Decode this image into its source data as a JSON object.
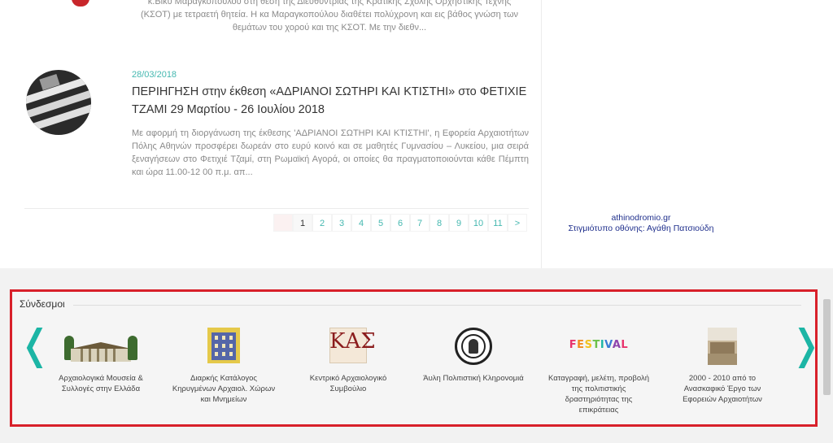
{
  "articles": {
    "top_excerpt": "κ.Βίκυ Μαραγκοπούλου στη θέση της Διευθύντριας της Κρατικής Σχολής Ορχηστικής Τέχνης (ΚΣΟΤ) με τετραετή θητεία. Η κα Μαραγκοπούλου διαθέτει πολύχρονη και εις βάθος γνώση των θεμάτων του χορού και της ΚΣΟΤ. Με την διεθν...",
    "main": {
      "date": "28/03/2018",
      "title": "ΠΕΡΙΗΓΗΣΗ στην έκθεση «ΑΔΡΙΑΝΟΙ ΣΩΤΗΡΙ ΚΑΙ ΚΤΙΣΤΗΙ» στο ΦΕΤΙΧΙΕ ΤΖΑΜΙ 29 Μαρτίου - 26 Ιουλίου 2018",
      "excerpt": "Με αφορμή τη διοργάνωση της έκθεσης 'ΑΔΡΙΑΝΟΙ ΣΩΤΗΡΙ ΚΑΙ ΚΤΙΣΤΗΙ', η Εφορεία Αρχαιοτήτων Πόλης Αθηνών προσφέρει δωρεάν στο ευρύ κοινό και σε μαθητές Γυμνασίου – Λυκείου, μια σειρά ξεναγήσεων στο Φετιχιέ Τζαμί, στη Ρωμαϊκή Αγορά, οι οποίες θα πραγματοποιούνται κάθε Πέμπτη και ώρα 11.00-12 00 π.μ. απ..."
    }
  },
  "pagination": {
    "pages": [
      "1",
      "2",
      "3",
      "4",
      "5",
      "6",
      "7",
      "8",
      "9",
      "10",
      "11"
    ],
    "next": ">",
    "active": "1"
  },
  "caption": {
    "line1": "athinodromio.gr",
    "line2": "Στιγμιότυπο οθόνης: Αγάθη Πατσιούδη"
  },
  "links": {
    "heading": "Σύνδεσμοι",
    "prev_arrow": "❬",
    "next_arrow": "❭",
    "items": [
      {
        "label": "Αρχαιολογικά Μουσεία & Συλλογές στην Ελλάδα",
        "icon": "museum-logo"
      },
      {
        "label": "Διαρκής Κατάλογος Κηρυγμένων Αρχαιολ. Χώρων και Μνημείων",
        "icon": "catalog-logo"
      },
      {
        "label": "Κεντρικό Αρχαιολογικό Συμβούλιο",
        "icon": "kas-logo",
        "logo_text": "ΚΑΣ"
      },
      {
        "label": "Άυλη Πολιτιστική Κληρονομιά",
        "icon": "seal-logo"
      },
      {
        "label": "Καταγραφή, μελέτη, προβολή της πολιτιστικής δραστηριότητας της επικράτειας",
        "icon": "festival-logo",
        "logo_text": "FESTIVAL"
      },
      {
        "label": "2000 - 2010 από το Ανασκαφικό Έργο των Εφορειών Αρχαιοτήτων",
        "icon": "photo-logo"
      }
    ]
  },
  "colors": {
    "accent": "#45b8b0",
    "frame": "#d8202a",
    "caption": "#1f2f8c"
  }
}
